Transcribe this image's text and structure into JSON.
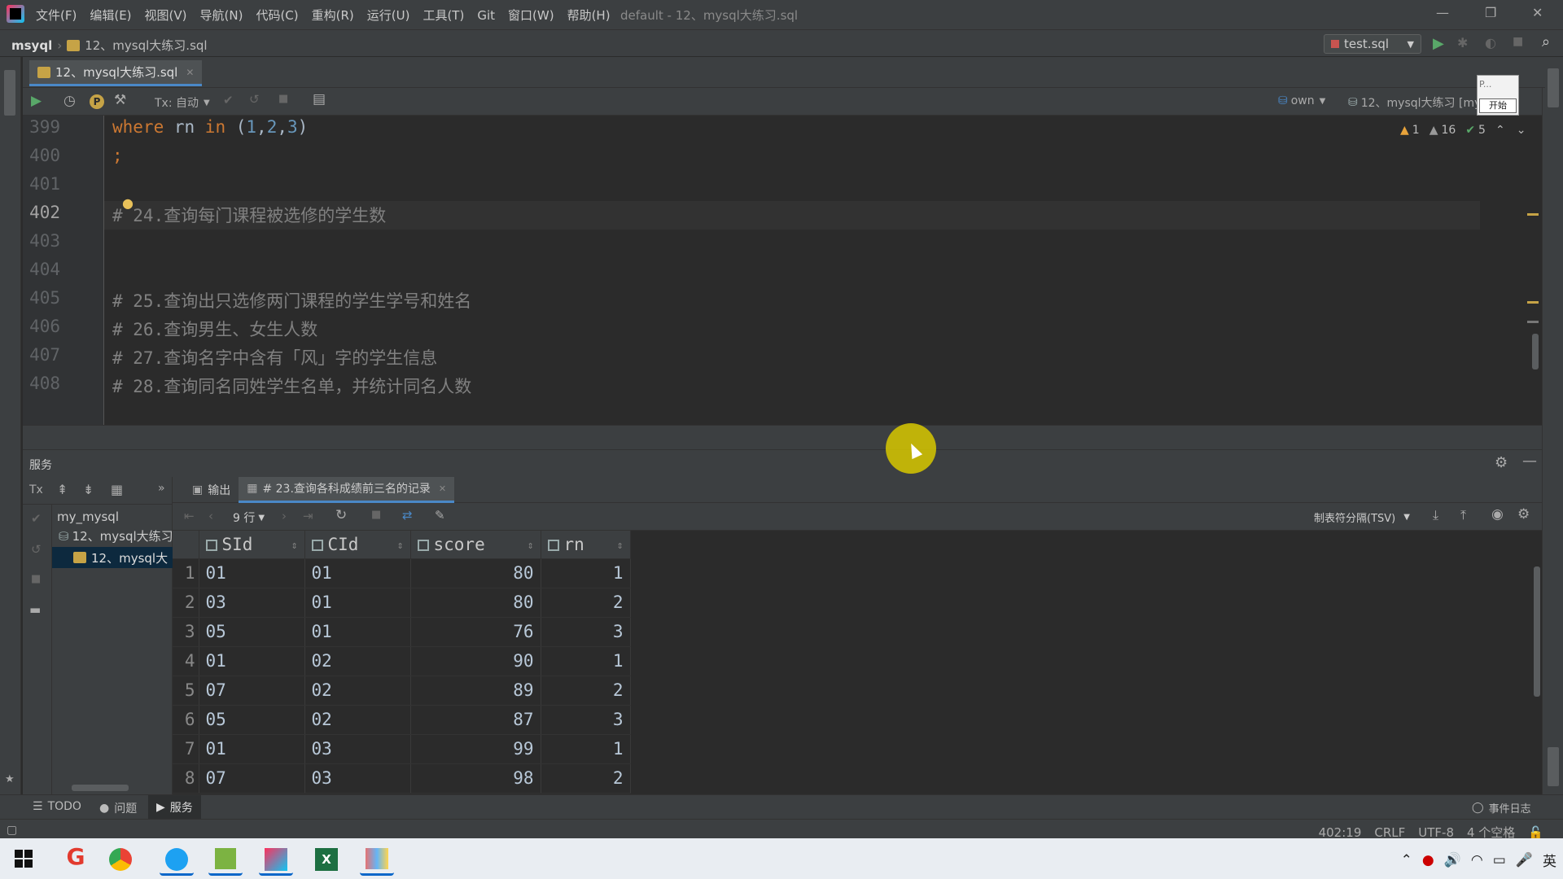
{
  "app": {
    "menu": [
      "文件(F)",
      "编辑(E)",
      "视图(V)",
      "导航(N)",
      "代码(C)",
      "重构(R)",
      "运行(U)",
      "工具(T)",
      "Git",
      "窗口(W)",
      "帮助(H)"
    ],
    "window_title": "default - 12、mysql大练习.sql"
  },
  "navbar": {
    "project": "msyql",
    "file": "12、mysql大练习.sql",
    "run_config": "test.sql"
  },
  "editor_tab": {
    "label": "12、mysql大练习.sql"
  },
  "editor_toolbar": {
    "tx_mode": "Tx: 自动",
    "schema": "own",
    "datasource": "12、mysql大练习 [my_",
    "popup_text": "P...",
    "popup_button": "开始"
  },
  "inspections": {
    "errors": "1",
    "warnings": "16",
    "ok": "5"
  },
  "code_lines": [
    {
      "num": "399",
      "parts": [
        {
          "t": "where",
          "c": "kw"
        },
        {
          "t": " rn ",
          "c": ""
        },
        {
          "t": "in",
          "c": "kw"
        },
        {
          "t": " (",
          "c": ""
        },
        {
          "t": "1",
          "c": "num"
        },
        {
          "t": ",",
          "c": ""
        },
        {
          "t": "2",
          "c": "num"
        },
        {
          "t": ",",
          "c": ""
        },
        {
          "t": "3",
          "c": "num"
        },
        {
          "t": ")",
          "c": ""
        }
      ]
    },
    {
      "num": "400",
      "parts": [
        {
          "t": ";",
          "c": "kw"
        }
      ]
    },
    {
      "num": "401",
      "parts": []
    },
    {
      "num": "402",
      "parts": [
        {
          "t": "# 24.查询每门课程被选修的学生数",
          "c": "cmt"
        }
      ]
    },
    {
      "num": "403",
      "parts": []
    },
    {
      "num": "404",
      "parts": []
    },
    {
      "num": "405",
      "parts": [
        {
          "t": "# 25.查询出只选修两门课程的学生学号和姓名",
          "c": "cmt"
        }
      ]
    },
    {
      "num": "406",
      "parts": [
        {
          "t": "# 26.查询男生、女生人数",
          "c": "cmt"
        }
      ]
    },
    {
      "num": "407",
      "parts": [
        {
          "t": "# 27.查询名字中含有「风」字的学生信息",
          "c": "cmt"
        }
      ]
    },
    {
      "num": "408",
      "parts": [
        {
          "t": "# 28.查询同名同姓学生名单，并统计同名人数",
          "c": "cmt"
        }
      ]
    }
  ],
  "services": {
    "title": "服务",
    "tree": [
      "my_mysql",
      "12、mysql大练习",
      "12、mysql大"
    ],
    "tabs": [
      "输出",
      "# 23.查询各科成绩前三名的记录"
    ],
    "rows_label": "9 行",
    "export_format": "制表符分隔(TSV)"
  },
  "result": {
    "columns": [
      "SId",
      "CId",
      "score",
      "rn"
    ],
    "rows": [
      [
        "1",
        "01",
        "01",
        "80",
        "1"
      ],
      [
        "2",
        "03",
        "01",
        "80",
        "2"
      ],
      [
        "3",
        "05",
        "01",
        "76",
        "3"
      ],
      [
        "4",
        "01",
        "02",
        "90",
        "1"
      ],
      [
        "5",
        "07",
        "02",
        "89",
        "2"
      ],
      [
        "6",
        "05",
        "02",
        "87",
        "3"
      ],
      [
        "7",
        "01",
        "03",
        "99",
        "1"
      ],
      [
        "8",
        "07",
        "03",
        "98",
        "2"
      ]
    ]
  },
  "toolstrip": {
    "todo": "TODO",
    "problems": "问题",
    "services": "服务",
    "event_log": "事件日志"
  },
  "statusbar": {
    "position": "402:19",
    "line_sep": "CRLF",
    "encoding": "UTF-8",
    "indent": "4 个空格"
  },
  "tray": {
    "ime": "英"
  }
}
